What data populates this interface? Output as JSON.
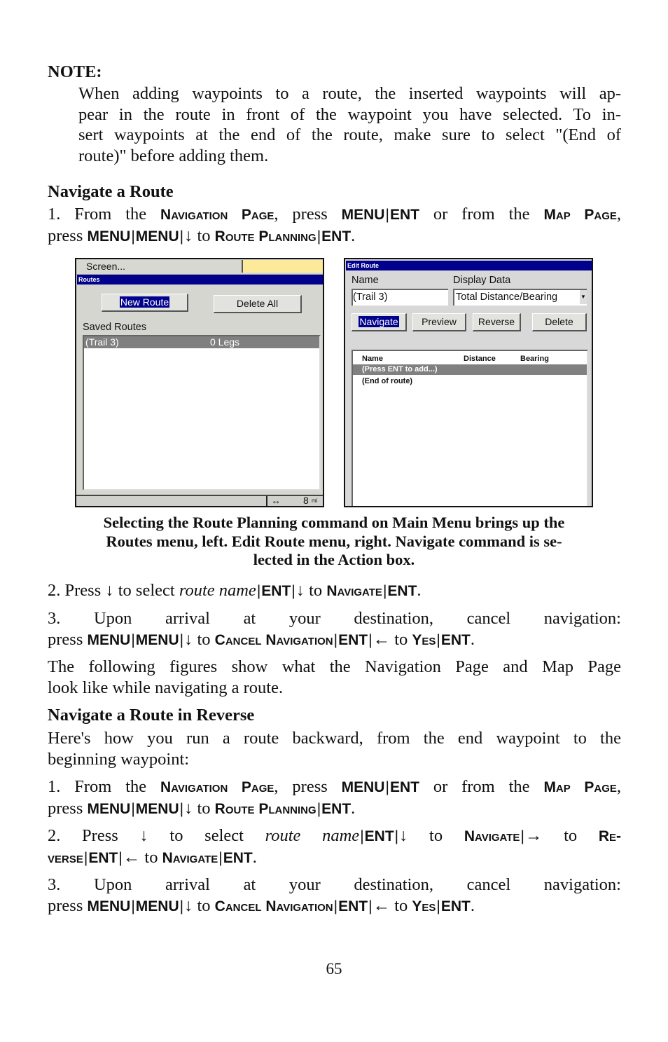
{
  "note": {
    "label": "NOTE:",
    "lines": [
      [
        {
          "t": "When adding waypoints to a route, the inserted waypoints will ap-"
        }
      ],
      [
        {
          "t": "pear in the route in front of the waypoint you have selected. To in-"
        }
      ],
      [
        {
          "t": "sert waypoints at the end of the route, make sure to select \"(End of"
        }
      ],
      [
        {
          "t": "route)\" before adding them."
        }
      ]
    ]
  },
  "section1": {
    "heading": "Navigate a Route",
    "step1": [
      [
        {
          "t": "1. From the "
        },
        {
          "t": "Navigation Page",
          "s": "sc"
        },
        {
          "t": ", press "
        },
        {
          "t": "MENU",
          "s": "b"
        },
        {
          "t": "|",
          "s": "sep"
        },
        {
          "t": "ENT",
          "s": "b"
        },
        {
          "t": " or from the "
        },
        {
          "t": "Map Page",
          "s": "sc"
        },
        {
          "t": ","
        }
      ],
      [
        {
          "t": "press "
        },
        {
          "t": "MENU",
          "s": "b"
        },
        {
          "t": "|",
          "s": "sep"
        },
        {
          "t": "MENU",
          "s": "b"
        },
        {
          "t": "|",
          "s": "sep"
        },
        {
          "t": "↓"
        },
        {
          "t": " to "
        },
        {
          "t": "Route Planning",
          "s": "sc"
        },
        {
          "t": "|",
          "s": "sep"
        },
        {
          "t": "ENT",
          "s": "b"
        },
        {
          "t": "."
        }
      ]
    ],
    "caption": [
      "Selecting the Route Planning command on Main Menu brings up the",
      "Routes menu, left. Edit Route menu, right. Navigate command is se-",
      "lected in the Action box."
    ],
    "step2": [
      [
        {
          "t": "2. Press "
        },
        {
          "t": "↓"
        },
        {
          "t": " to select "
        },
        {
          "t": "route name",
          "s": "i"
        },
        {
          "t": "|",
          "s": "sep"
        },
        {
          "t": "ENT",
          "s": "b"
        },
        {
          "t": "|",
          "s": "sep"
        },
        {
          "t": "↓"
        },
        {
          "t": " to "
        },
        {
          "t": "Navigate",
          "s": "sc"
        },
        {
          "t": "|",
          "s": "sep"
        },
        {
          "t": "ENT",
          "s": "b"
        },
        {
          "t": "."
        }
      ]
    ],
    "step3": [
      [
        {
          "t": "3. Upon arrival at your destination, cancel navigation:"
        }
      ],
      [
        {
          "t": "press "
        },
        {
          "t": "MENU",
          "s": "b"
        },
        {
          "t": "|",
          "s": "sep"
        },
        {
          "t": "MENU",
          "s": "b"
        },
        {
          "t": "|",
          "s": "sep"
        },
        {
          "t": "↓"
        },
        {
          "t": " to "
        },
        {
          "t": "Cancel Navigation",
          "s": "sc"
        },
        {
          "t": "|",
          "s": "sep"
        },
        {
          "t": "ENT",
          "s": "b"
        },
        {
          "t": "|",
          "s": "sep"
        },
        {
          "t": "←"
        },
        {
          "t": " to "
        },
        {
          "t": "Yes",
          "s": "sc"
        },
        {
          "t": "|",
          "s": "sep"
        },
        {
          "t": "ENT",
          "s": "b"
        },
        {
          "t": "."
        }
      ]
    ],
    "para": [
      [
        {
          "t": "The following figures show what the Navigation Page and Map Page"
        }
      ],
      [
        {
          "t": "look like while navigating a route."
        }
      ]
    ]
  },
  "section2": {
    "heading": "Navigate a Route in Reverse",
    "para": [
      [
        {
          "t": "Here's how you run a route backward, from the end waypoint to the"
        }
      ],
      [
        {
          "t": "beginning waypoint:"
        }
      ]
    ],
    "step1": [
      [
        {
          "t": "1. From the "
        },
        {
          "t": "Navigation Page",
          "s": "sc"
        },
        {
          "t": ", press "
        },
        {
          "t": "MENU",
          "s": "b"
        },
        {
          "t": "|",
          "s": "sep"
        },
        {
          "t": "ENT",
          "s": "b"
        },
        {
          "t": " or from the "
        },
        {
          "t": "Map Page",
          "s": "sc"
        },
        {
          "t": ","
        }
      ],
      [
        {
          "t": "press "
        },
        {
          "t": "MENU",
          "s": "b"
        },
        {
          "t": "|",
          "s": "sep"
        },
        {
          "t": "MENU",
          "s": "b"
        },
        {
          "t": "|",
          "s": "sep"
        },
        {
          "t": "↓"
        },
        {
          "t": " to "
        },
        {
          "t": "Route Planning",
          "s": "sc"
        },
        {
          "t": "|",
          "s": "sep"
        },
        {
          "t": "ENT",
          "s": "b"
        },
        {
          "t": "."
        }
      ]
    ],
    "step2": [
      [
        {
          "t": "2. Press "
        },
        {
          "t": "↓"
        },
        {
          "t": " to select "
        },
        {
          "t": "route name",
          "s": "i"
        },
        {
          "t": "|",
          "s": "sep"
        },
        {
          "t": "ENT",
          "s": "b"
        },
        {
          "t": "|",
          "s": "sep"
        },
        {
          "t": "↓"
        },
        {
          "t": " to "
        },
        {
          "t": "Navigate",
          "s": "sc"
        },
        {
          "t": "|",
          "s": "sep"
        },
        {
          "t": "→"
        },
        {
          "t": " to "
        },
        {
          "t": "Re-",
          "s": "sc"
        }
      ],
      [
        {
          "t": "verse",
          "s": "sc"
        },
        {
          "t": "|",
          "s": "sep"
        },
        {
          "t": "ENT",
          "s": "b"
        },
        {
          "t": "|",
          "s": "sep"
        },
        {
          "t": "←"
        },
        {
          "t": " to "
        },
        {
          "t": "Navigate",
          "s": "sc"
        },
        {
          "t": "|",
          "s": "sep"
        },
        {
          "t": "ENT",
          "s": "b"
        },
        {
          "t": "."
        }
      ]
    ],
    "step3": [
      [
        {
          "t": "3. Upon arrival at your destination, cancel navigation:"
        }
      ],
      [
        {
          "t": "press "
        },
        {
          "t": "MENU",
          "s": "b"
        },
        {
          "t": "|",
          "s": "sep"
        },
        {
          "t": "MENU",
          "s": "b"
        },
        {
          "t": "|",
          "s": "sep"
        },
        {
          "t": "↓"
        },
        {
          "t": " to "
        },
        {
          "t": "Cancel Navigation",
          "s": "sc"
        },
        {
          "t": "|",
          "s": "sep"
        },
        {
          "t": "ENT",
          "s": "b"
        },
        {
          "t": "|",
          "s": "sep"
        },
        {
          "t": "←"
        },
        {
          "t": " to "
        },
        {
          "t": "Yes",
          "s": "sc"
        },
        {
          "t": "|",
          "s": "sep"
        },
        {
          "t": "ENT",
          "s": "b"
        },
        {
          "t": "."
        }
      ]
    ]
  },
  "routes_screen": {
    "menu_item": "Screen...",
    "title": "Routes",
    "new_route": "New Route",
    "delete_all": "Delete All",
    "saved_routes_label": "Saved Routes",
    "route_name": "(Trail 3)",
    "route_legs": "0 Legs",
    "scale_icon": "↔",
    "scale_value": "8",
    "scale_unit": "mi"
  },
  "edit_route_screen": {
    "title": "Edit Route",
    "name_label": "Name",
    "name_value": "(Trail 3)",
    "display_label": "Display Data",
    "display_value": "Total Distance/Bearing",
    "buttons": {
      "navigate": "Navigate",
      "preview": "Preview",
      "reverse": "Reverse",
      "delete": "Delete"
    },
    "columns": [
      "Name",
      "Distance",
      "Bearing"
    ],
    "rows": [
      "(Press ENT to add...)",
      "(End of route)"
    ]
  },
  "colors": {
    "title_bar": "#00008c",
    "selection": "#808080"
  },
  "page_number": "65"
}
